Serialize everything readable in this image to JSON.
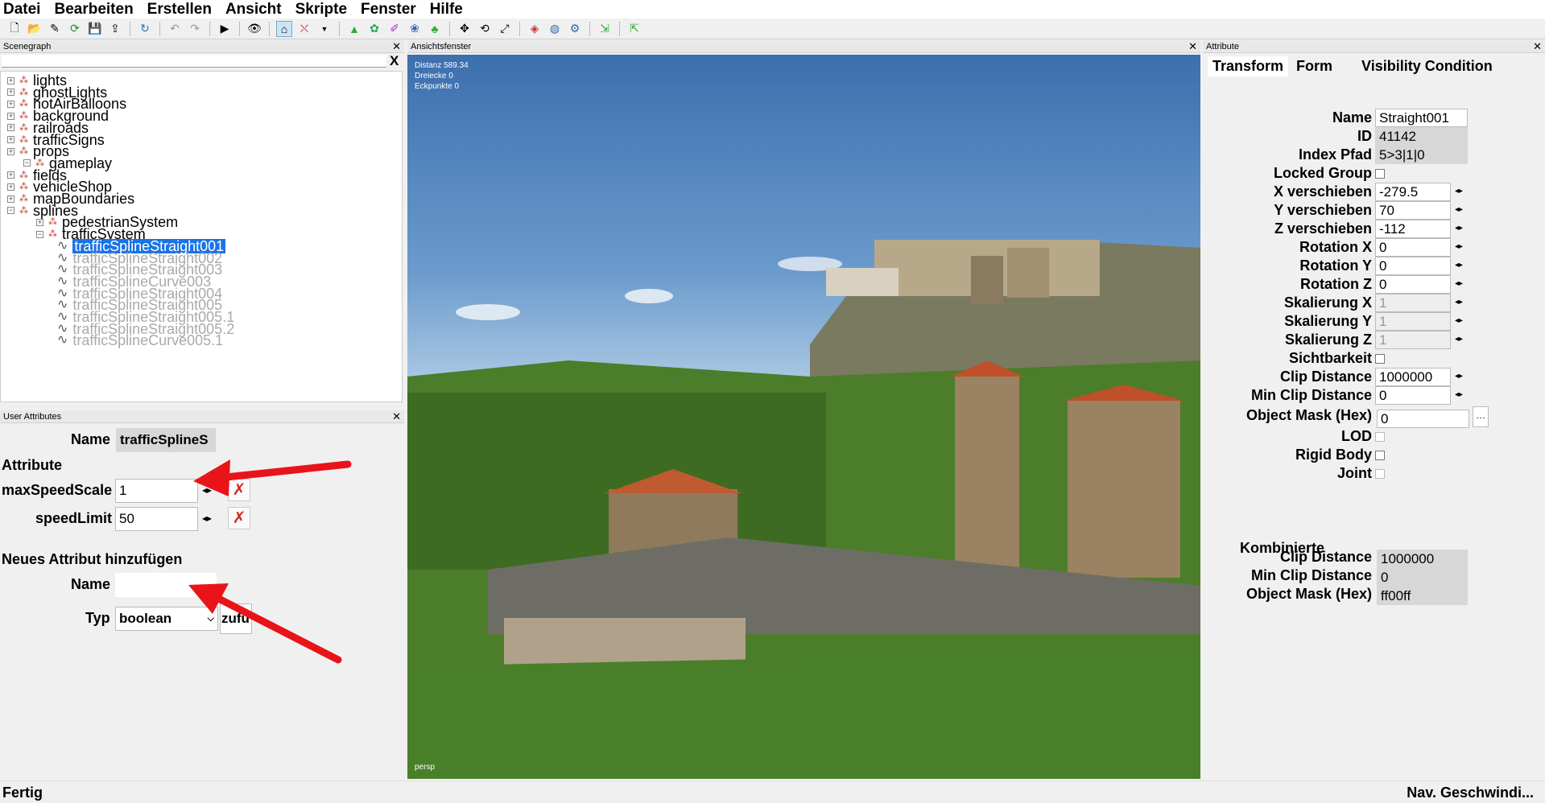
{
  "menu": [
    "Datei",
    "Bearbeiten",
    "Erstellen",
    "Ansicht",
    "Skripte",
    "Fenster",
    "Hilfe"
  ],
  "scenegraph": {
    "title": "Scenegraph",
    "filter_value": "",
    "clear_label": "X",
    "tree": [
      {
        "label": "lights",
        "level": 1,
        "expander": "+",
        "icon": "node",
        "dim": false,
        "selected": false
      },
      {
        "label": "ghostLights",
        "level": 1,
        "expander": "+",
        "icon": "node",
        "dim": false,
        "selected": false
      },
      {
        "label": "hotAirBalloons",
        "level": 1,
        "expander": "+",
        "icon": "node",
        "dim": false,
        "selected": false
      },
      {
        "label": "background",
        "level": 1,
        "expander": "+",
        "icon": "node",
        "dim": false,
        "selected": false
      },
      {
        "label": "railroads",
        "level": 1,
        "expander": "+",
        "icon": "node",
        "dim": false,
        "selected": false
      },
      {
        "label": "trafficSigns",
        "level": 1,
        "expander": "+",
        "icon": "node",
        "dim": false,
        "selected": false
      },
      {
        "label": "props",
        "level": 1,
        "expander": "+",
        "icon": "node",
        "dim": false,
        "selected": false
      },
      {
        "label": "gameplay",
        "level": 0,
        "expander": "-",
        "icon": "node",
        "dim": false,
        "selected": false
      },
      {
        "label": "fields",
        "level": 1,
        "expander": "+",
        "icon": "node",
        "dim": false,
        "selected": false
      },
      {
        "label": "vehicleShop",
        "level": 1,
        "expander": "+",
        "icon": "node",
        "dim": false,
        "selected": false
      },
      {
        "label": "mapBoundaries",
        "level": 1,
        "expander": "+",
        "icon": "node",
        "dim": false,
        "selected": false
      },
      {
        "label": "splines",
        "level": 1,
        "expander": "-",
        "icon": "node",
        "dim": false,
        "selected": false
      },
      {
        "label": "pedestrianSystem",
        "level": 2,
        "expander": "+",
        "icon": "node",
        "dim": false,
        "selected": false
      },
      {
        "label": "trafficSystem",
        "level": 2,
        "expander": "-",
        "icon": "node",
        "dim": false,
        "selected": false
      },
      {
        "label": "trafficSplineStraight001",
        "level": 3,
        "expander": "",
        "icon": "spline",
        "dim": false,
        "selected": true
      },
      {
        "label": "trafficSplineStraight002",
        "level": 3,
        "expander": "",
        "icon": "spline",
        "dim": true,
        "selected": false
      },
      {
        "label": "trafficSplineStraight003",
        "level": 3,
        "expander": "",
        "icon": "spline",
        "dim": true,
        "selected": false
      },
      {
        "label": "trafficSplineCurve003",
        "level": 3,
        "expander": "",
        "icon": "spline",
        "dim": true,
        "selected": false
      },
      {
        "label": "trafficSplineStraight004",
        "level": 3,
        "expander": "",
        "icon": "spline",
        "dim": true,
        "selected": false
      },
      {
        "label": "trafficSplineStraight005",
        "level": 3,
        "expander": "",
        "icon": "spline",
        "dim": true,
        "selected": false
      },
      {
        "label": "trafficSplineStraight005.1",
        "level": 3,
        "expander": "",
        "icon": "spline",
        "dim": true,
        "selected": false
      },
      {
        "label": "trafficSplineStraight005.2",
        "level": 3,
        "expander": "",
        "icon": "spline",
        "dim": true,
        "selected": false
      },
      {
        "label": "trafficSplineCurve005.1",
        "level": 3,
        "expander": "",
        "icon": "spline",
        "dim": true,
        "selected": false
      }
    ]
  },
  "user_attributes": {
    "title": "User Attributes",
    "name_label": "Name",
    "name_value": "trafficSplineS",
    "section_attribute": "Attribute",
    "attrs": [
      {
        "label": "maxSpeedScale",
        "value": "1"
      },
      {
        "label": "speedLimit",
        "value": "50"
      }
    ],
    "section_new": "Neues Attribut hinzufügen",
    "new_name_label": "Name",
    "new_name_value": "",
    "new_type_label": "Typ",
    "new_type_value": "boolean",
    "add_button": "zufü"
  },
  "viewport": {
    "title": "Ansichtsfenster",
    "stats": [
      "Distanz 589.34",
      "Dreiecke 0",
      "Eckpunkte 0"
    ],
    "camera": "persp"
  },
  "attribute": {
    "title": "Attribute",
    "tabs": [
      "Transform",
      "Form",
      "Visibility Condition"
    ],
    "rows": [
      {
        "label": "Name",
        "type": "text",
        "value": "Straight001",
        "ro": false
      },
      {
        "label": "ID",
        "type": "text",
        "value": "41142",
        "ro": true
      },
      {
        "label": "Index Pfad",
        "type": "text",
        "value": "5>3|1|0",
        "ro": true
      },
      {
        "label": "Locked Group",
        "type": "check"
      },
      {
        "label": "X verschieben",
        "type": "num",
        "value": "-279.5"
      },
      {
        "label": "Y verschieben",
        "type": "num",
        "value": "70"
      },
      {
        "label": "Z verschieben",
        "type": "num",
        "value": "-112"
      },
      {
        "label": "Rotation X",
        "type": "num",
        "value": "0"
      },
      {
        "label": "Rotation Y",
        "type": "num",
        "value": "0"
      },
      {
        "label": "Rotation Z",
        "type": "num",
        "value": "0"
      },
      {
        "label": "Skalierung X",
        "type": "numdis",
        "value": "1"
      },
      {
        "label": "Skalierung Y",
        "type": "numdis",
        "value": "1"
      },
      {
        "label": "Skalierung Z",
        "type": "numdis",
        "value": "1"
      },
      {
        "label": "Sichtbarkeit",
        "type": "check"
      },
      {
        "label": "Clip Distance",
        "type": "num",
        "value": "1000000"
      },
      {
        "label": "Min Clip Distance",
        "type": "num",
        "value": "0"
      },
      {
        "label": "Object Mask (Hex)",
        "type": "mask",
        "value": "0"
      },
      {
        "label": "LOD",
        "type": "checkdis"
      },
      {
        "label": "Rigid Body",
        "type": "check"
      },
      {
        "label": "Joint",
        "type": "checkdis"
      }
    ],
    "combined_header": "Kombinierte",
    "combined_rows": [
      {
        "label": "Clip Distance",
        "value": "1000000"
      },
      {
        "label": "Min Clip Distance",
        "value": "0"
      },
      {
        "label": "Object Mask (Hex)",
        "value": "ff00ff"
      }
    ]
  },
  "status": {
    "left": "Fertig",
    "right": "Nav. Geschwindi..."
  }
}
